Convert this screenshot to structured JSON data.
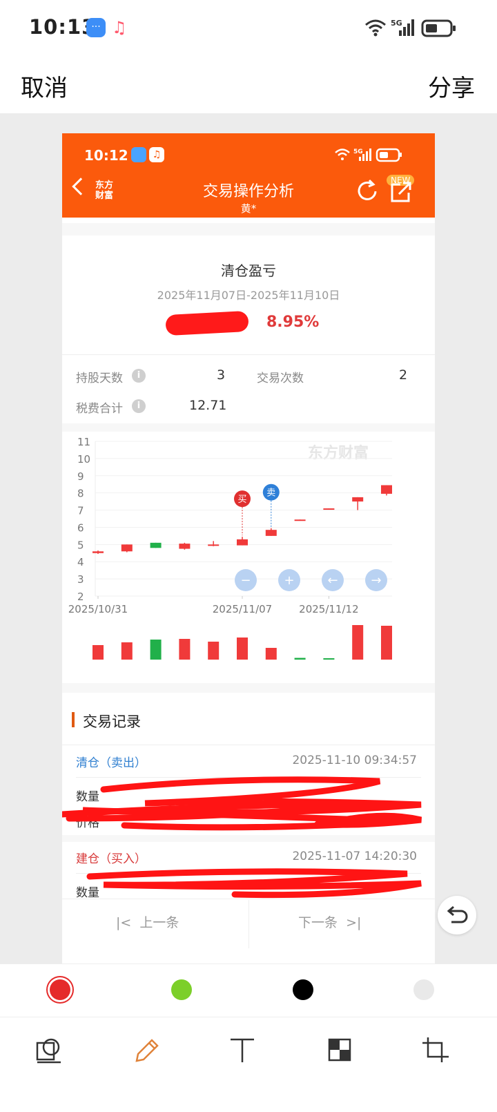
{
  "os_status": {
    "time": "10:13",
    "network": "5G"
  },
  "editor": {
    "cancel_label": "取消",
    "share_label": "分享"
  },
  "inner_app": {
    "status_time": "10:12",
    "network": "5G",
    "title": "交易操作分析",
    "subtitle": "黄*",
    "brand": [
      "东方",
      "财富"
    ],
    "new_badge": "NEW"
  },
  "summary": {
    "title": "清仓盈亏",
    "date_range": "2025年11月07日-2025年11月10日",
    "profit_pct": "8.95%"
  },
  "stats": {
    "hold_days_label": "持股天数",
    "hold_days_value": "3",
    "trade_count_label": "交易次数",
    "trade_count_value": "2",
    "tax_label": "税费合计",
    "tax_value": "12.71"
  },
  "chart_data": {
    "type": "candlestick",
    "watermark": "东方财富",
    "ylim": [
      2,
      11
    ],
    "y_ticks": [
      "11",
      "10",
      "9",
      "8",
      "7",
      "6",
      "5",
      "4",
      "3",
      "2"
    ],
    "x_tick_labels": [
      "2025/10/31",
      "2025/11/07",
      "2025/11/12"
    ],
    "markers": [
      {
        "label": "买",
        "index": 5,
        "color": "#e03030"
      },
      {
        "label": "卖",
        "index": 6,
        "color": "#2f80d8"
      }
    ],
    "candles": [
      {
        "open": 4.5,
        "close": 4.6,
        "high": 4.65,
        "low": 4.45,
        "dir": "up"
      },
      {
        "open": 4.6,
        "close": 5.0,
        "high": 5.0,
        "low": 4.55,
        "dir": "up"
      },
      {
        "open": 5.1,
        "close": 4.8,
        "high": 5.1,
        "low": 4.8,
        "dir": "down"
      },
      {
        "open": 4.75,
        "close": 5.05,
        "high": 5.1,
        "low": 4.7,
        "dir": "up"
      },
      {
        "open": 4.95,
        "close": 5.0,
        "high": 5.2,
        "low": 4.9,
        "dir": "up"
      },
      {
        "open": 4.95,
        "close": 5.3,
        "high": 5.45,
        "low": 4.95,
        "dir": "up"
      },
      {
        "open": 5.5,
        "close": 5.85,
        "high": 5.95,
        "low": 5.5,
        "dir": "up"
      },
      {
        "open": 6.4,
        "close": 6.45,
        "high": 6.45,
        "low": 6.4,
        "dir": "up"
      },
      {
        "open": 7.05,
        "close": 7.1,
        "high": 7.1,
        "low": 7.05,
        "dir": "up"
      },
      {
        "open": 7.5,
        "close": 7.75,
        "high": 7.75,
        "low": 7.0,
        "dir": "up"
      },
      {
        "open": 7.95,
        "close": 8.45,
        "high": 8.45,
        "low": 7.85,
        "dir": "up"
      }
    ],
    "volume": [
      0.42,
      0.5,
      0.58,
      0.6,
      0.52,
      0.64,
      0.34,
      0.05,
      0.04,
      1.0,
      0.98
    ],
    "volume_dir": [
      "up",
      "up",
      "down",
      "up",
      "up",
      "up",
      "up",
      "down",
      "down",
      "up",
      "up"
    ],
    "up_color": "#f03a3a",
    "down_color": "#21b04a"
  },
  "records": {
    "section_title": "交易记录",
    "items": [
      {
        "type": "清仓（卖出）",
        "time": "2025-11-10 09:34:57",
        "qty_label": "数量",
        "price_label": "价格",
        "type_color": "#2f7fd0"
      },
      {
        "type": "建仓（买入）",
        "time": "2025-11-07 14:20:30",
        "qty_label": "数量",
        "type_color": "#d83a3a"
      }
    ]
  },
  "pager": {
    "prev_label": "上一条",
    "next_label": "下一条"
  },
  "palette": [
    "#e52a2a",
    "#7ccf2a",
    "#000000",
    "#e9e9e9"
  ],
  "tools": [
    "shape-tool-icon",
    "pencil-icon",
    "text-icon",
    "mosaic-icon",
    "crop-icon"
  ]
}
